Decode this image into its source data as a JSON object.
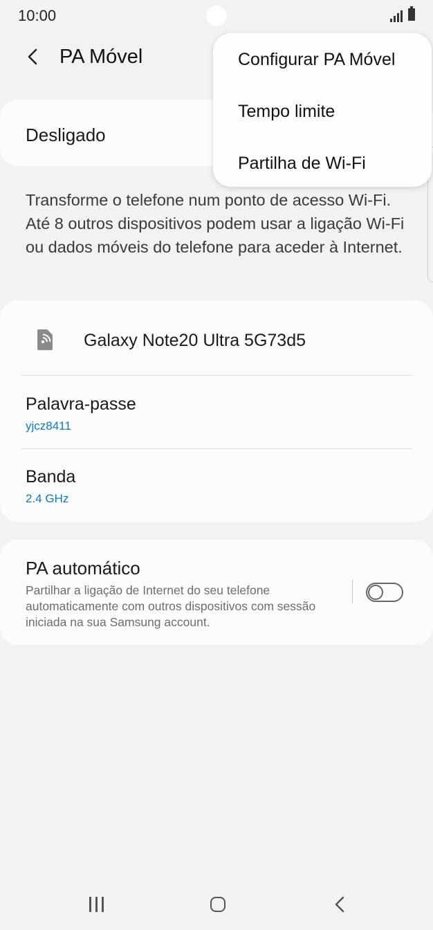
{
  "status_bar": {
    "time": "10:00"
  },
  "app_bar": {
    "title": "PA Móvel"
  },
  "hotspot": {
    "state_label": "Desligado"
  },
  "description": "Transforme o telefone num ponto de acesso Wi-Fi. Até 8 outros dispositivos podem usar a ligação Wi-Fi ou dados móveis do telefone para aceder à Internet.",
  "network": {
    "name": "Galaxy Note20 Ultra 5G73d5",
    "password_label": "Palavra-passe",
    "password_value": "yjcz8411",
    "band_label": "Banda",
    "band_value": "2.4 GHz"
  },
  "auto_hotspot": {
    "title": "PA automático",
    "description": "Partilhar a ligação de Internet do seu telefone automaticamente com outros dispositivos com sessão iniciada na sua Samsung account.",
    "enabled": false
  },
  "overflow_menu": {
    "items": [
      {
        "label": "Configurar PA Móvel"
      },
      {
        "label": "Tempo limite"
      },
      {
        "label": "Partilha de Wi-Fi"
      }
    ]
  },
  "colors": {
    "accent": "#0a7bc6",
    "background": "#f2f2f2",
    "card": "#fcfcfc"
  },
  "icons": [
    "signal-icon",
    "battery-icon",
    "back-arrow-icon",
    "hotspot-icon",
    "recents-icon",
    "home-icon",
    "nav-back-icon"
  ]
}
